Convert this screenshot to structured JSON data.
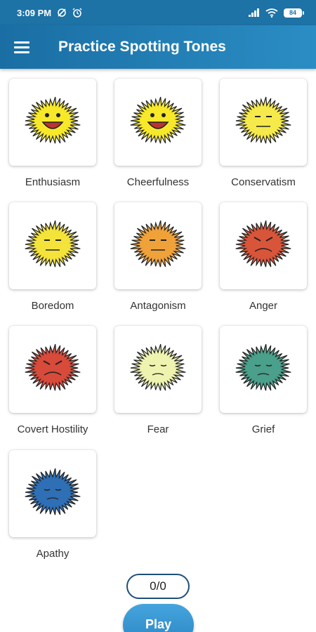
{
  "status_bar": {
    "time": "3:09 PM",
    "battery": "84"
  },
  "app_bar": {
    "title": "Practice Spotting Tones"
  },
  "tones": [
    {
      "label": "Enthusiasm",
      "icon": "enthusiasm-creature-icon",
      "color": "#f7e92a"
    },
    {
      "label": "Cheerfulness",
      "icon": "cheerfulness-creature-icon",
      "color": "#f7e92a"
    },
    {
      "label": "Conservatism",
      "icon": "conservatism-creature-icon",
      "color": "#f5ea4a"
    },
    {
      "label": "Boredom",
      "icon": "boredom-creature-icon",
      "color": "#f4e33a"
    },
    {
      "label": "Antagonism",
      "icon": "antagonism-creature-icon",
      "color": "#f0a23a"
    },
    {
      "label": "Anger",
      "icon": "anger-creature-icon",
      "color": "#d9553a"
    },
    {
      "label": "Covert Hostility",
      "icon": "covert-hostility-creature-icon",
      "color": "#d84a3a"
    },
    {
      "label": "Fear",
      "icon": "fear-creature-icon",
      "color": "#eef3b0"
    },
    {
      "label": "Grief",
      "icon": "grief-creature-icon",
      "color": "#4aa08a"
    },
    {
      "label": "Apathy",
      "icon": "apathy-creature-icon",
      "color": "#2f6fb5"
    }
  ],
  "score": "0/0",
  "play_label": "Play",
  "colors": {
    "status_bar": "#1d72a6",
    "app_bar_start": "#1a6ea3",
    "app_bar_end": "#2a8dc4",
    "play_button": "#3596d0",
    "score_border": "#1d4f7a"
  }
}
